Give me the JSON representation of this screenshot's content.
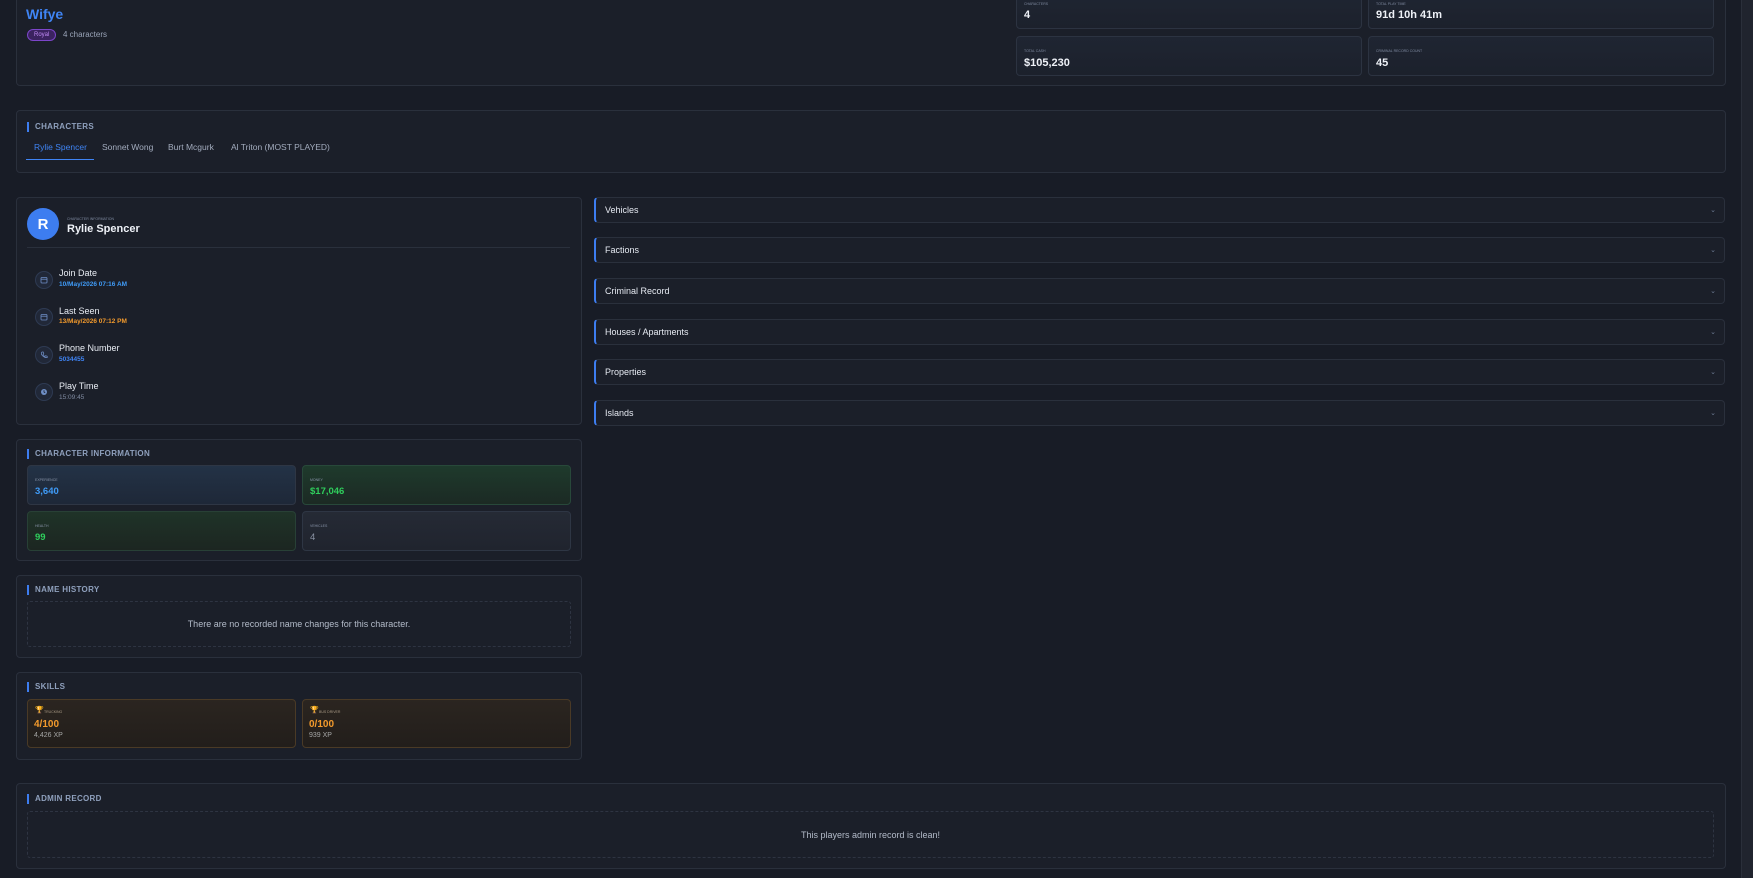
{
  "header": {
    "player_name": "Wifye",
    "badge": "Royal",
    "character_count": "4 characters",
    "stats": [
      {
        "label": "Characters",
        "value": "4"
      },
      {
        "label": "Total Play Time",
        "value": "91d 10h 41m"
      },
      {
        "label": "Total Cash",
        "value": "$105,230"
      },
      {
        "label": "Criminal Record Count",
        "value": "45"
      }
    ]
  },
  "characters": {
    "title": "Characters",
    "tabs": [
      "Rylie Spencer",
      "Sonnet Wong",
      "Burt Mcgurk",
      "Al Triton (MOST PLAYED)"
    ],
    "active_tab": 0
  },
  "profile": {
    "avatar_letter": "R",
    "label": "Character Information",
    "name": "Rylie Spencer",
    "rows": [
      {
        "title": "Join Date",
        "value": "10/May/2026 07:16 AM",
        "color": "#3f9bf7",
        "icon": "calendar-icon"
      },
      {
        "title": "Last Seen",
        "value": "13/May/2026 07:12 PM",
        "color": "#f39a2c",
        "icon": "calendar-icon"
      },
      {
        "title": "Phone Number",
        "value": "5034455",
        "color": "#3f84f4",
        "icon": "phone-icon"
      },
      {
        "title": "Play Time",
        "value": "15:09:45",
        "color": "#7f8aa0",
        "icon": "clock-icon"
      }
    ]
  },
  "character_information": {
    "title": "Character Information",
    "cards": [
      {
        "label": "Experience",
        "value": "3,640",
        "color": "#3f9bf7"
      },
      {
        "label": "Money",
        "value": "$17,046",
        "color": "#2fce5c"
      },
      {
        "label": "Health",
        "value": "99",
        "color": "#2fce5c"
      },
      {
        "label": "Vehicles",
        "value": "4",
        "color": "#8a93a4"
      }
    ]
  },
  "name_history": {
    "title": "Name History",
    "empty_text": "There are no recorded name changes for this character."
  },
  "skills": {
    "title": "Skills",
    "items": [
      {
        "label": "Trucking",
        "value": "4/100",
        "xp": "4,426 XP"
      },
      {
        "label": "Bus Driver",
        "value": "0/100",
        "xp": "939 XP"
      }
    ]
  },
  "admin_record": {
    "title": "Admin Record",
    "empty_text": "This players admin record is clean!"
  },
  "accordion": [
    "Vehicles",
    "Factions",
    "Criminal Record",
    "Houses / Apartments",
    "Properties",
    "Islands"
  ],
  "colors": {
    "accent": "#3d7df0",
    "background": "#181c26"
  }
}
